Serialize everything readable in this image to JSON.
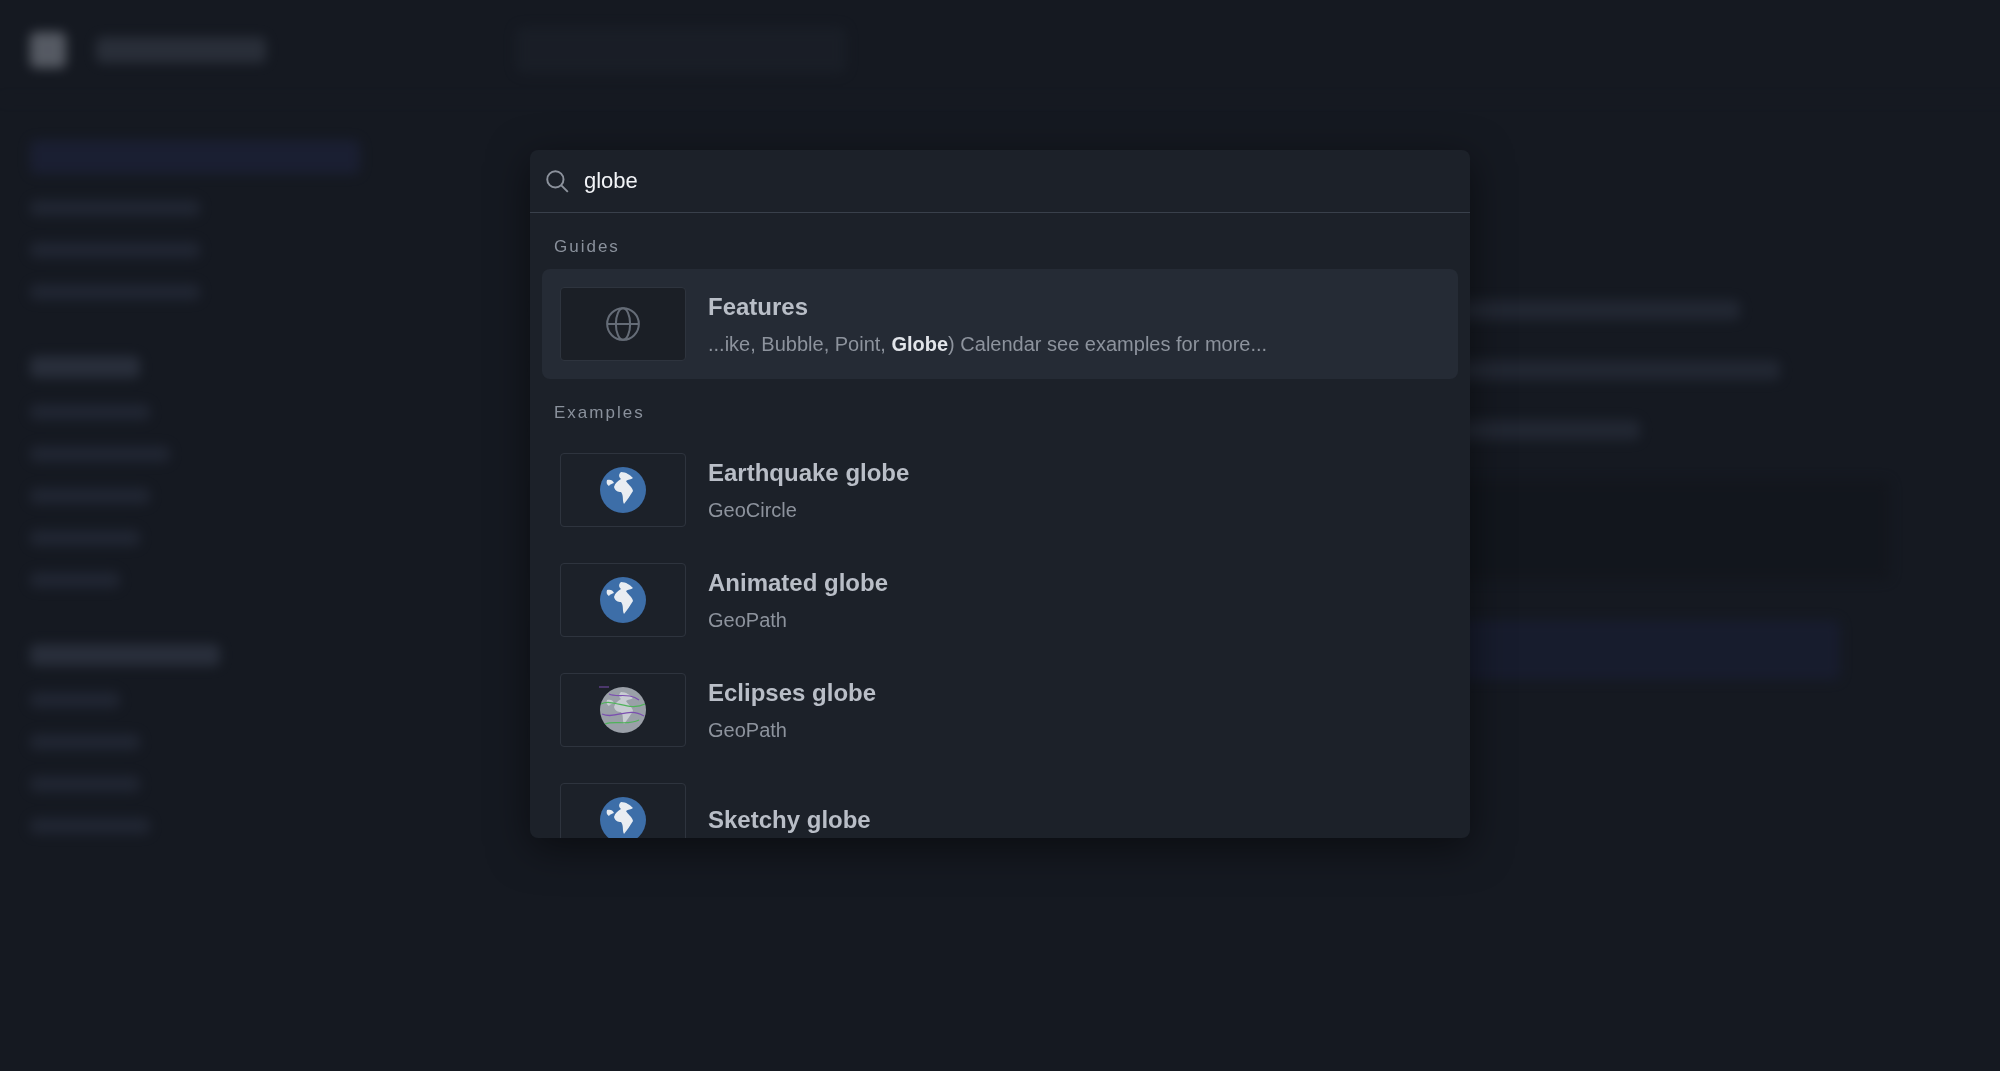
{
  "search": {
    "value": "globe"
  },
  "groups": [
    {
      "heading": "Guides",
      "items": [
        {
          "kind": "guide",
          "title": "Features",
          "excerpt": "...ike, Bubble, Point, **Globe**) Calendar see examples for more...",
          "selected": true
        }
      ]
    },
    {
      "heading": "Examples",
      "items": [
        {
          "kind": "globe",
          "title": "Earthquake globe",
          "subtitle": "GeoCircle",
          "selected": false
        },
        {
          "kind": "globe",
          "title": "Animated globe",
          "subtitle": "GeoPath",
          "selected": false
        },
        {
          "kind": "tracks-globe",
          "title": "Eclipses globe",
          "subtitle": "GeoPath",
          "selected": false
        },
        {
          "kind": "globe",
          "title": "Sketchy globe",
          "selected": false
        }
      ]
    }
  ]
}
